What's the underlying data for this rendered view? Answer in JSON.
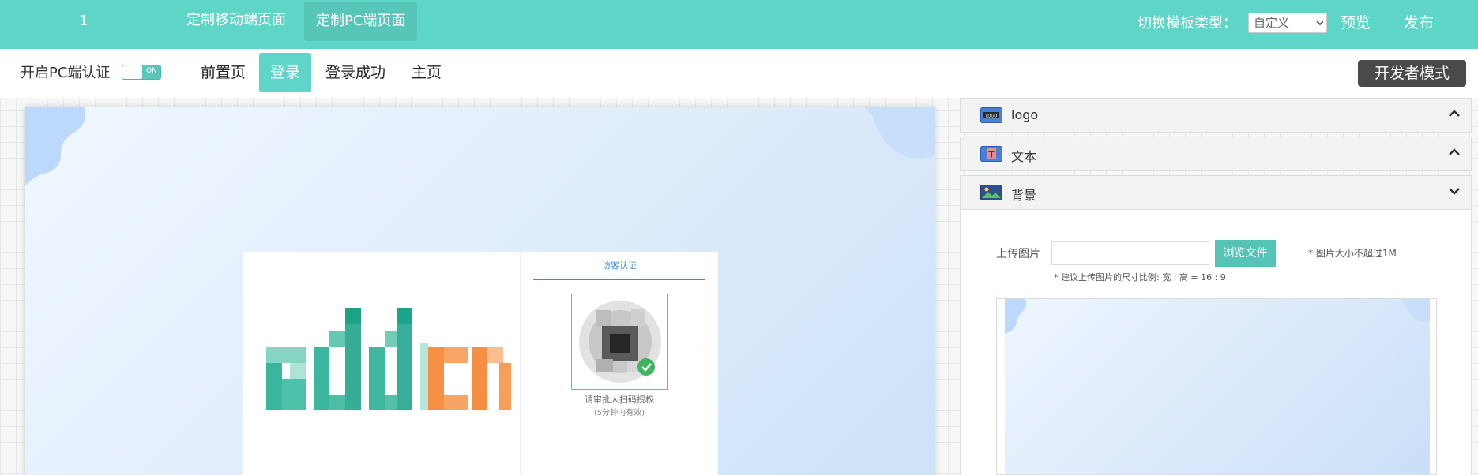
{
  "topbar": {
    "number": "1",
    "tabs": [
      "定制移动端页面",
      "定制PC端页面"
    ],
    "template_type_label": "切换模板类型：",
    "template_select_value": "自定义",
    "preview_label": "预览",
    "publish_label": "发布"
  },
  "subbar": {
    "auth_toggle_label": "开启PC端认证",
    "toggle_text": "ON",
    "page_tabs": [
      "前置页",
      "登录",
      "登录成功",
      "主页"
    ],
    "active_tab": "登录",
    "developer_mode_label": "开发者模式"
  },
  "canvas": {
    "logo_letters_green": "add",
    "logo_letters_orange": "cn",
    "auth_tab_label": "访客认证",
    "qr_tip": "请审批人扫码授权",
    "qr_validity": "(5分钟内有效)"
  },
  "right_panel": {
    "sections": [
      {
        "title": "logo",
        "icon": "logo-icon",
        "expanded": false
      },
      {
        "title": "文本",
        "icon": "text-icon",
        "expanded": false
      },
      {
        "title": "背景",
        "icon": "image-icon",
        "expanded": true
      }
    ],
    "background": {
      "upload_label": "上传图片",
      "browse_label": "浏览文件",
      "size_note": "* 图片大小不超过1M",
      "ratio_hint": "* 建议上传图片的尺寸比例: 宽 : 高 = 16 : 9"
    }
  },
  "colors": {
    "brand": "#5fd5c8",
    "active_tab": "#57c6b9",
    "dev_button": "#4a4a4a",
    "link_blue": "#3b88d9",
    "logo_green": "#15a88b",
    "logo_orange": "#f5832f"
  }
}
